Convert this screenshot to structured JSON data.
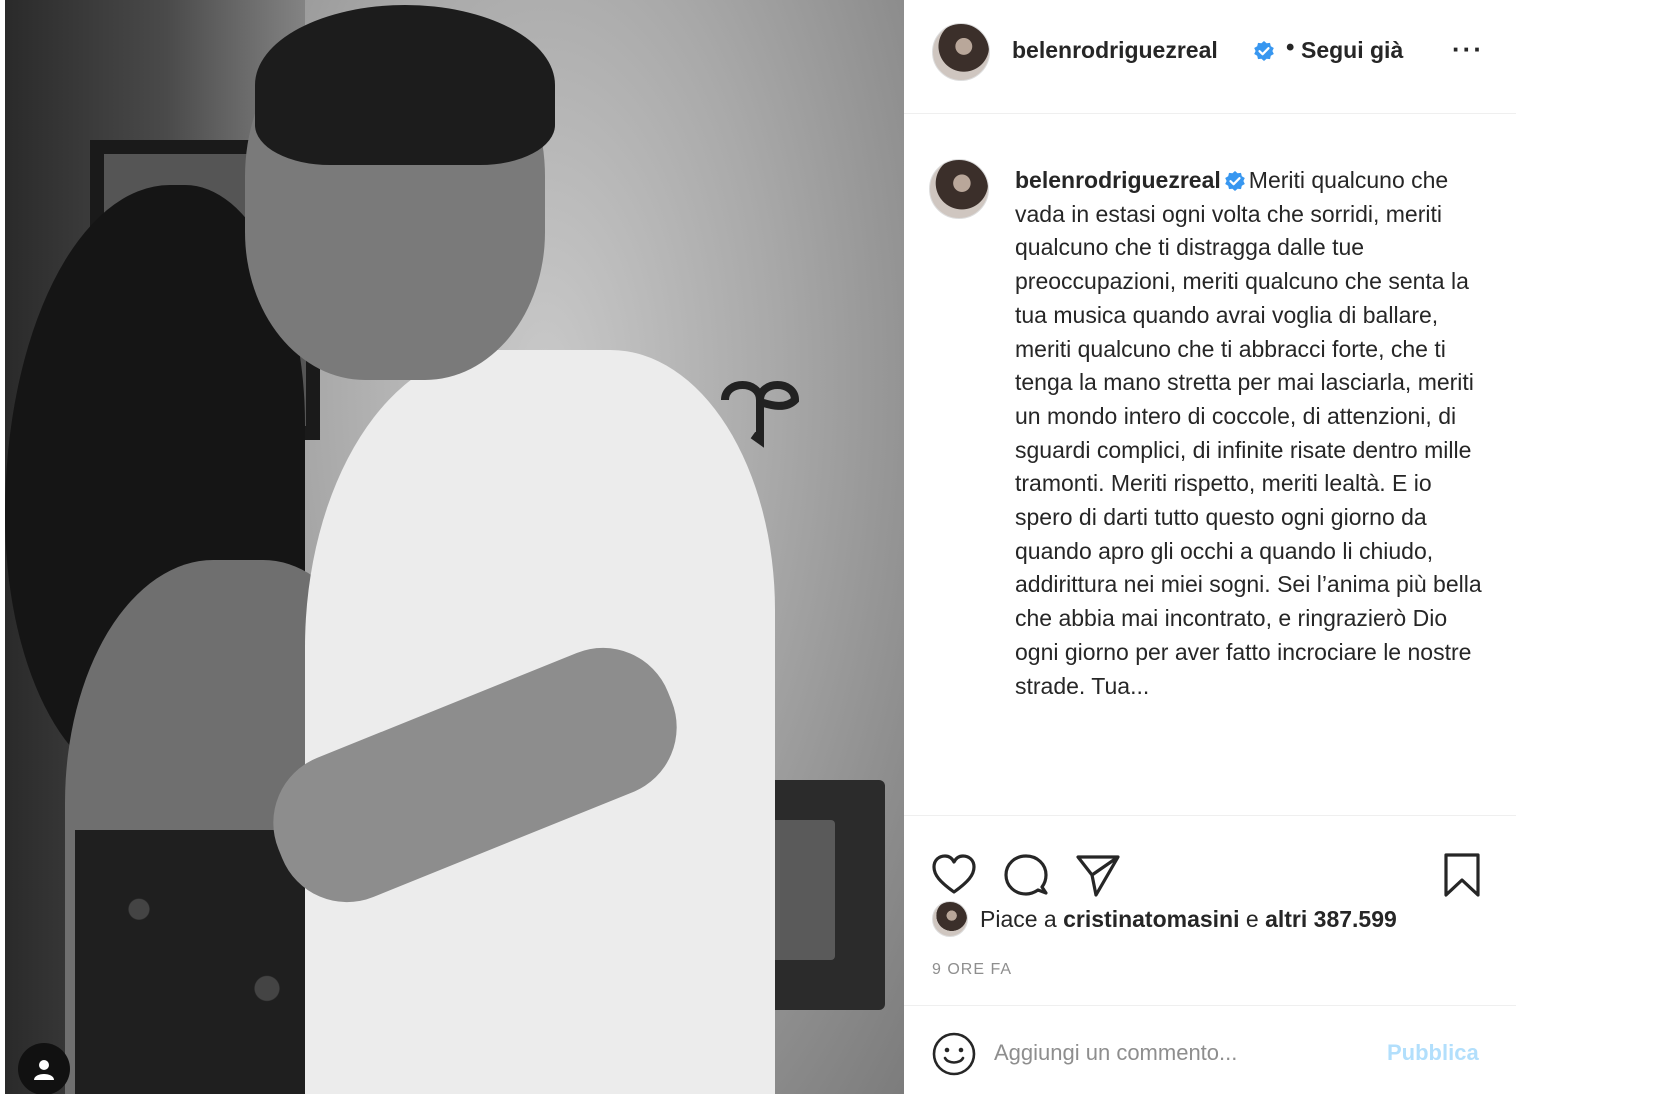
{
  "header": {
    "username": "belenrodriguezreal",
    "separator": "•",
    "follow_label": "Segui già",
    "more_label": "···"
  },
  "caption": {
    "username": "belenrodriguezreal",
    "text": "Meriti qualcuno che vada in estasi ogni volta che sorridi, meriti qualcuno che ti distragga dalle tue preoccupazioni, meriti qualcuno che senta la tua musica quando avrai voglia di ballare, meriti qualcuno che ti abbracci forte, che ti tenga la mano stretta per mai lasciarla, meriti un mondo intero di coccole, di attenzioni, di sguardi complici, di infinite risate dentro mille tramonti. Meriti rispetto, meriti lealtà. E io spero di darti tutto questo ogni giorno da quando apro gli occhi a quando li chiudo, addirittura nei miei sogni. Sei l’anima più bella che abbia mai incontrato, e ringrazierò Dio ogni giorno per aver fatto incrociare le nostre strade. Tua..."
  },
  "actions": {
    "icons": [
      "heart-icon",
      "comment-icon",
      "share-icon",
      "bookmark-icon"
    ]
  },
  "likes": {
    "prefix": "Piace a",
    "user": "cristinatomasini",
    "middle": "e",
    "others": "altri 387.599"
  },
  "time_ago": "9 ORE FA",
  "comment": {
    "placeholder": "Aggiungi un commento...",
    "publish_label": "Pubblica"
  },
  "colors": {
    "verified": "#3897f0",
    "publish_disabled": "#b2dffc",
    "muted": "#8e8e8e",
    "text": "#262626"
  }
}
